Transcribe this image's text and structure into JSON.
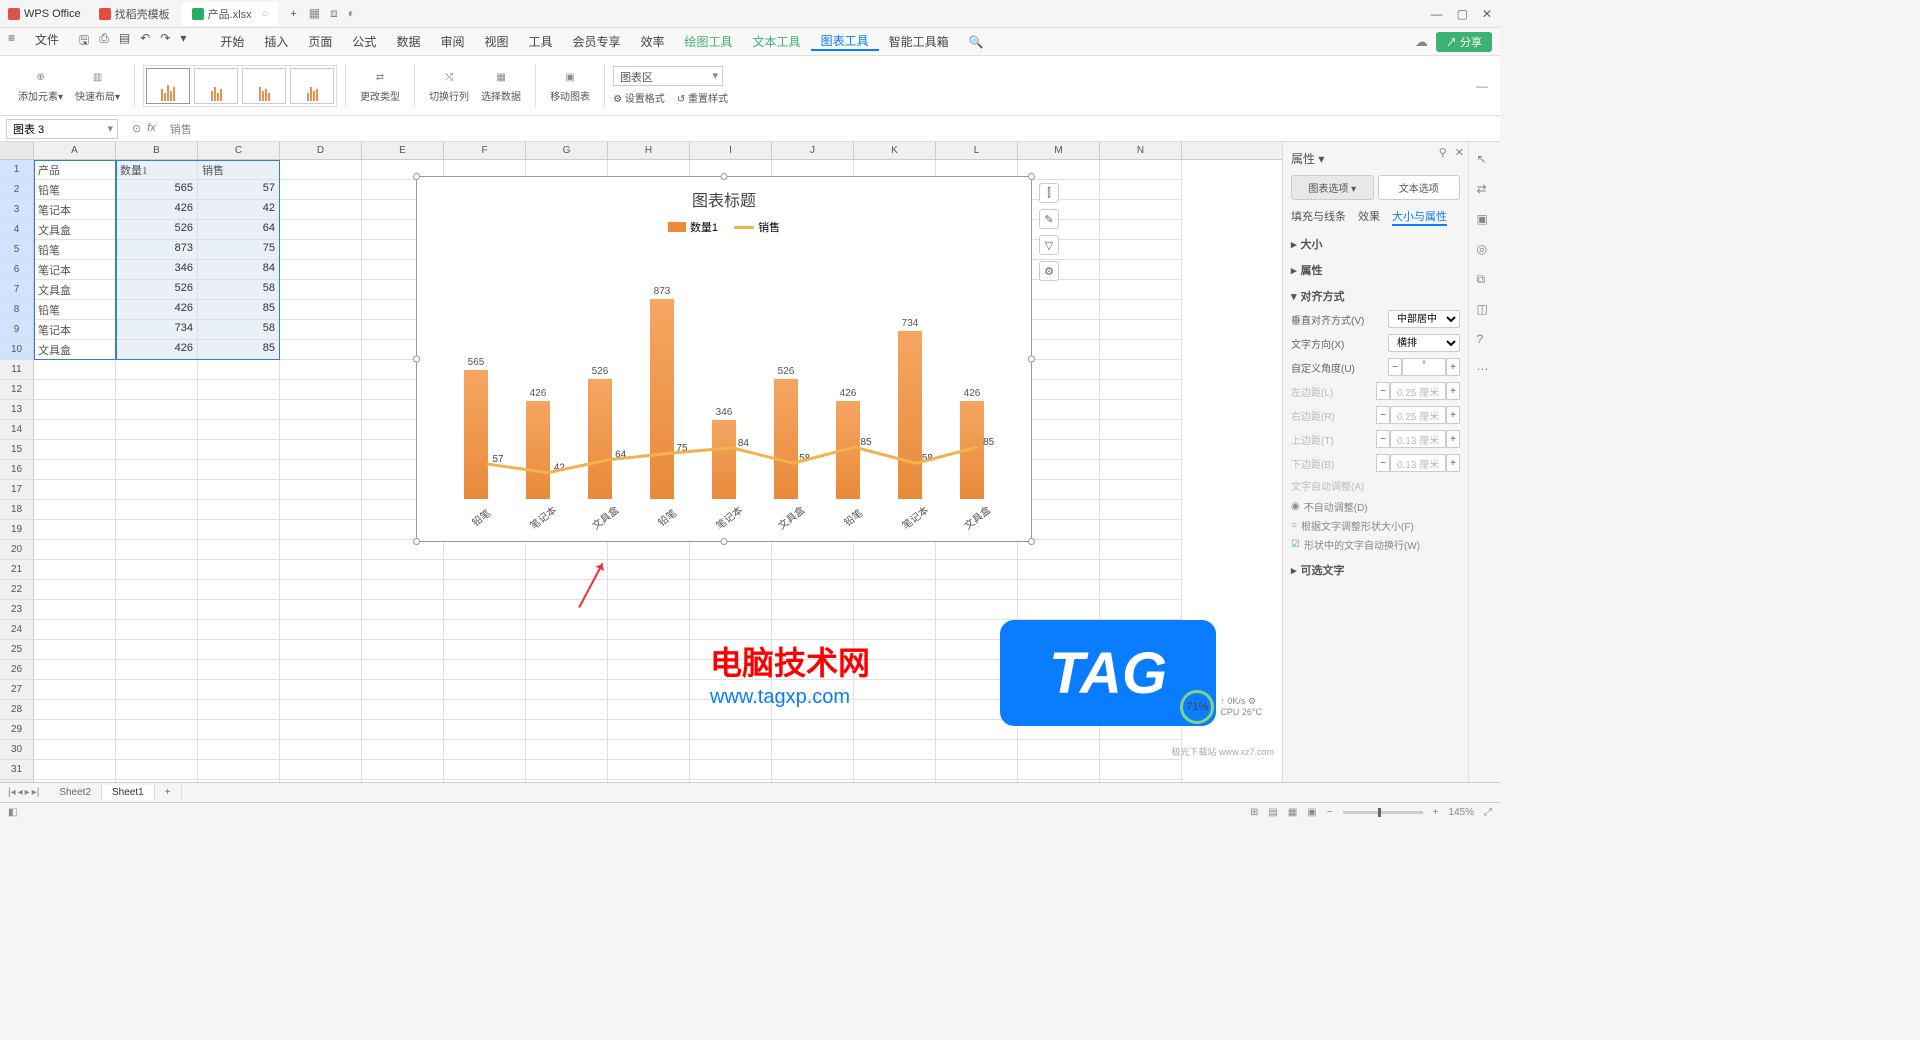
{
  "titlebar": {
    "app_name": "WPS Office",
    "tabs": [
      {
        "label": "找稻壳模板"
      },
      {
        "label": "产品.xlsx"
      }
    ],
    "add_tab": "+"
  },
  "menubar": {
    "file": "文件",
    "items": [
      "开始",
      "插入",
      "页面",
      "公式",
      "数据",
      "审阅",
      "视图",
      "工具",
      "会员专享",
      "效率",
      "绘图工具",
      "文本工具",
      "图表工具",
      "智能工具箱"
    ]
  },
  "share_label": "分享",
  "ribbon": {
    "add_element": "添加元素▾",
    "quick_layout": "快速布局▾",
    "change_type": "更改类型",
    "switch_rowcol": "切换行列",
    "select_data": "选择数据",
    "move_chart": "移动图表",
    "chart_area_label": "图表区",
    "set_format": "设置格式",
    "reset_style": "重置样式"
  },
  "name_box": "图表 3",
  "formula_bar": "销售",
  "columns": [
    "A",
    "B",
    "C",
    "D",
    "E",
    "F",
    "G",
    "H",
    "I",
    "J",
    "K",
    "L",
    "M",
    "N"
  ],
  "rows_visible": 33,
  "table": {
    "headers": [
      "产品",
      "数量1",
      "销售"
    ],
    "rows": [
      [
        "铅笔",
        "565",
        "57"
      ],
      [
        "笔记本",
        "426",
        "42"
      ],
      [
        "文具盒",
        "526",
        "64"
      ],
      [
        "铅笔",
        "873",
        "75"
      ],
      [
        "笔记本",
        "346",
        "84"
      ],
      [
        "文具盒",
        "526",
        "58"
      ],
      [
        "铅笔",
        "426",
        "85"
      ],
      [
        "笔记本",
        "734",
        "58"
      ],
      [
        "文具盒",
        "426",
        "85"
      ]
    ]
  },
  "chart_data": {
    "type": "bar",
    "title": "图表标题",
    "categories": [
      "铅笔",
      "笔记本",
      "文具盒",
      "铅笔",
      "笔记本",
      "文具盒",
      "铅笔",
      "笔记本",
      "文具盒"
    ],
    "series": [
      {
        "name": "数量1",
        "values": [
          565,
          426,
          526,
          873,
          346,
          526,
          426,
          734,
          426
        ],
        "color": "#ed8a3c"
      },
      {
        "name": "销售",
        "values": [
          57,
          42,
          64,
          75,
          84,
          58,
          85,
          58,
          85
        ],
        "color": "#f3b24c",
        "type": "line"
      }
    ],
    "ylim": [
      0,
      1000
    ]
  },
  "rpanel": {
    "title": "属性 ▾",
    "tab_chart": "图表选项 ▾",
    "tab_text": "文本选项",
    "subtabs": [
      "填充与线条",
      "效果",
      "大小与属性"
    ],
    "size_h": "大小",
    "props_h": "属性",
    "align_h": "对齐方式",
    "v_align_label": "垂直对齐方式(V)",
    "v_align_val": "中部居中",
    "text_dir_label": "文字方向(X)",
    "text_dir_val": "横排",
    "custom_angle_label": "自定义角度(U)",
    "custom_angle_val": "°",
    "margin_left_label": "左边距(L)",
    "margin_left_val": "0.25 厘米",
    "margin_right_label": "右边距(R)",
    "margin_right_val": "0.25 厘米",
    "margin_top_label": "上边距(T)",
    "margin_top_val": "0.13 厘米",
    "margin_bottom_label": "下边距(B)",
    "margin_bottom_val": "0.13 厘米",
    "autofit_label": "文字自动调整(A)",
    "radio_noauto": "不自动调整(D)",
    "radio_resize": "根据文字调整形状大小(F)",
    "check_wrap": "形状中的文字自动换行(W)",
    "alt_text_h": "可选文字"
  },
  "sheets": {
    "sheet2": "Sheet2",
    "sheet1": "Sheet1"
  },
  "status": {
    "zoom": "145%"
  },
  "cpu": {
    "percent": "71%",
    "line1": "0K/s",
    "line2": "CPU 26°C"
  },
  "watermark": {
    "text": "电脑技术网",
    "url": "www.tagxp.com",
    "tag": "TAG"
  },
  "jiguang": "极光下载站 www.xz7.com"
}
